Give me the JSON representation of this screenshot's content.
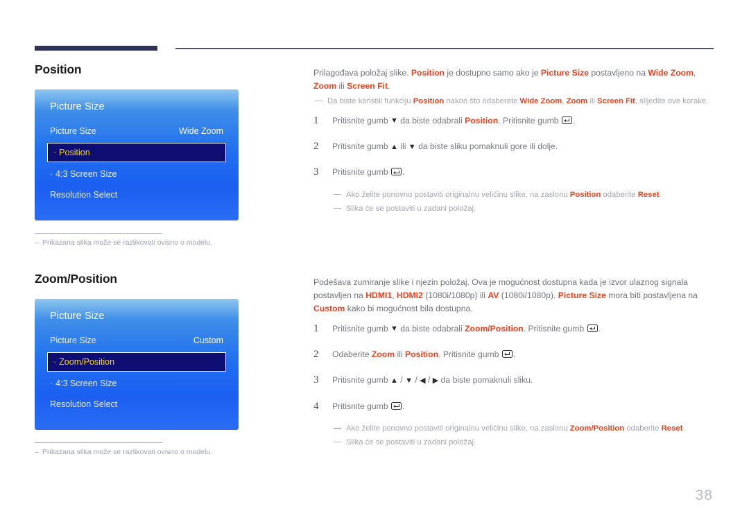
{
  "page": {
    "number": "38"
  },
  "sections": [
    {
      "title": "Position",
      "osd": {
        "title": "Picture Size",
        "rows": [
          {
            "label": "Picture Size",
            "value": "Wide Zoom",
            "sub": false,
            "highlight": false
          },
          {
            "label": "Position",
            "value": "",
            "sub": true,
            "highlight": true
          },
          {
            "label": "4:3 Screen Size",
            "value": "",
            "sub": true,
            "highlight": false
          },
          {
            "label": "Resolution Select",
            "value": "",
            "sub": false,
            "highlight": false
          }
        ]
      },
      "footnote": "Prikazana slika može se razlikovati ovisno o modelu.",
      "footnote_dash": "–",
      "intro": {
        "lead_1": "Prilagođava položaj slike. ",
        "kw_1": "Position",
        "lead_2": " je dostupno samo ako je ",
        "kw_2": "Picture Size",
        "lead_3": " postavljeno na ",
        "kw_3": "Wide Zoom",
        "lead_4": ", ",
        "kw_4": "Zoom",
        "lead_5": " ili ",
        "kw_5": "Screen Fit",
        "lead_6": "."
      },
      "note_top": {
        "t1": "Da biste koristili funkciju ",
        "k1": "Position",
        "t2": " nakon što odaberete ",
        "k2": "Wide Zoom",
        "t3": ", ",
        "k3": "Zoom",
        "t4": " ili ",
        "k4": "Screen Fit",
        "t5": ", slijedite ove korake."
      },
      "steps": [
        {
          "num": "1",
          "t1": "Pritisnite gumb ",
          "glyph1": "▼",
          "t2": " da biste odabrali ",
          "kw": "Position",
          "t3": ". Pritisnite gumb ",
          "t4": "."
        },
        {
          "num": "2",
          "t1": "Pritisnite gumb ",
          "glyph1": "▲",
          "t2": " ili ",
          "glyph2": "▼",
          "t3": " da biste sliku pomaknuli gore ili dolje."
        },
        {
          "num": "3",
          "t1": "Pritisnite gumb ",
          "t4": "."
        }
      ],
      "notes_after": [
        {
          "t1": "Ako želite ponovno postaviti originalnu veličinu slike, na zaslonu ",
          "k1": "Position",
          "t2": " odaberite ",
          "k2": "Reset",
          "t3": "."
        },
        {
          "t1": "Slika će se postaviti u zadani položaj."
        }
      ]
    },
    {
      "title": "Zoom/Position",
      "osd": {
        "title": "Picture Size",
        "rows": [
          {
            "label": "Picture Size",
            "value": "Custom",
            "sub": false,
            "highlight": false
          },
          {
            "label": "Zoom/Position",
            "value": "",
            "sub": true,
            "highlight": true
          },
          {
            "label": "4:3 Screen Size",
            "value": "",
            "sub": true,
            "highlight": false
          },
          {
            "label": "Resolution Select",
            "value": "",
            "sub": false,
            "highlight": false
          }
        ]
      },
      "footnote": "Prikazana slika može se razlikovati ovisno o modelu.",
      "footnote_dash": "–",
      "intro": {
        "lead_1": "Podešava zumiranje slike i njezin položaj. Ova je mogućnost dostupna kada je izvor ulaznog signala postavljen na ",
        "kw_1": "HDMI1",
        "lead_2": ", ",
        "kw_2": "HDMI2",
        "lead_3": " (1080i/1080p) ili ",
        "kw_3": "AV",
        "lead_4": " (1080i/1080p). ",
        "kw_4": "Picture Size",
        "lead_5": " mora biti postavljena na ",
        "kw_5": "Custom",
        "lead_6": " kako bi mogućnost bila dostupna."
      },
      "steps": [
        {
          "num": "1",
          "t1": "Pritisnite gumb ",
          "glyph1": "▼",
          "t2": " da biste odabrali ",
          "kw": "Zoom/Position",
          "t3": ". Pritisnite gumb ",
          "t4": "."
        },
        {
          "num": "2",
          "t1": "Odaberite ",
          "kw": "Zoom",
          "t2": " ili ",
          "kw2": "Position",
          "t3": ". Pritisnite gumb ",
          "t4": "."
        },
        {
          "num": "3",
          "t1": "Pritisnite gumb ",
          "glyph1": "▲",
          "sep1": " / ",
          "glyph2": "▼",
          "sep2": " / ",
          "glyph3": "◀",
          "sep3": " / ",
          "glyph4": "▶",
          "t3": " da biste pomaknuli sliku."
        },
        {
          "num": "4",
          "t1": "Pritisnite gumb ",
          "t4": "."
        }
      ],
      "notes_after": [
        {
          "t1": "Ako želite ponovno postaviti originalnu veličinu slike, na zaslonu ",
          "k1": "Zoom/Position",
          "t2": " odaberite ",
          "k2": "Reset",
          "t3": "."
        },
        {
          "t1": "Slika će se postaviti u zadani položaj."
        }
      ]
    }
  ]
}
